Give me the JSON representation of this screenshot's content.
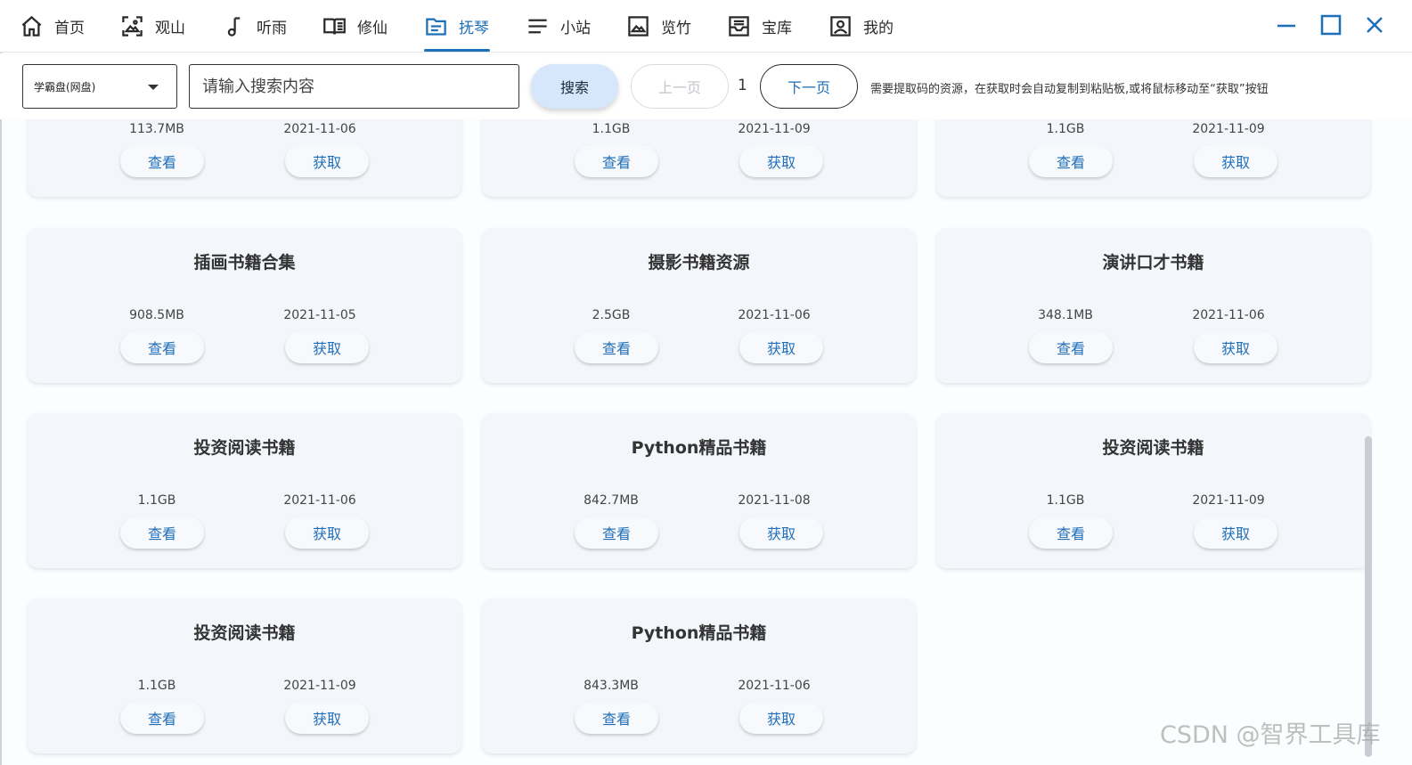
{
  "nav": {
    "items": [
      {
        "label": "首页",
        "icon": "home-icon"
      },
      {
        "label": "观山",
        "icon": "image-scan-icon"
      },
      {
        "label": "听雨",
        "icon": "music-note-icon"
      },
      {
        "label": "修仙",
        "icon": "book-open-icon"
      },
      {
        "label": "抚琴",
        "icon": "folder-icon"
      },
      {
        "label": "小站",
        "icon": "menu-lines-icon"
      },
      {
        "label": "览竹",
        "icon": "picture-icon"
      },
      {
        "label": "宝库",
        "icon": "inbox-icon"
      },
      {
        "label": "我的",
        "icon": "profile-icon"
      }
    ],
    "active": "抚琴",
    "accent_color": "#1f6fb8"
  },
  "window_controls": {
    "minimize": "minimize-icon",
    "maximize": "maximize-icon",
    "close": "close-icon"
  },
  "toolbar": {
    "source_selected": "学霸盘(网盘)",
    "search_placeholder": "请输入搜索内容",
    "search_label": "搜索",
    "prev_label": "上一页",
    "page": "1",
    "next_label": "下一页",
    "hint": "需要提取码的资源，在获取时会自动复制到粘贴板,或将鼠标移动至“获取”按钮"
  },
  "card_actions": {
    "view_label": "查看",
    "get_label": "获取"
  },
  "cards": [
    {
      "title": "",
      "size": "113.7MB",
      "date": "2021-11-06"
    },
    {
      "title": "",
      "size": "1.1GB",
      "date": "2021-11-09"
    },
    {
      "title": "",
      "size": "1.1GB",
      "date": "2021-11-09"
    },
    {
      "title": "插画书籍合集",
      "size": "908.5MB",
      "date": "2021-11-05"
    },
    {
      "title": "摄影书籍资源",
      "size": "2.5GB",
      "date": "2021-11-06"
    },
    {
      "title": "演讲口才书籍",
      "size": "348.1MB",
      "date": "2021-11-06"
    },
    {
      "title": "投资阅读书籍",
      "size": "1.1GB",
      "date": "2021-11-06"
    },
    {
      "title": "Python精品书籍",
      "size": "842.7MB",
      "date": "2021-11-08"
    },
    {
      "title": "投资阅读书籍",
      "size": "1.1GB",
      "date": "2021-11-09"
    },
    {
      "title": "投资阅读书籍",
      "size": "1.1GB",
      "date": "2021-11-09"
    },
    {
      "title": "Python精品书籍",
      "size": "843.3MB",
      "date": "2021-11-06"
    }
  ],
  "watermark": "CSDN @智界工具库"
}
